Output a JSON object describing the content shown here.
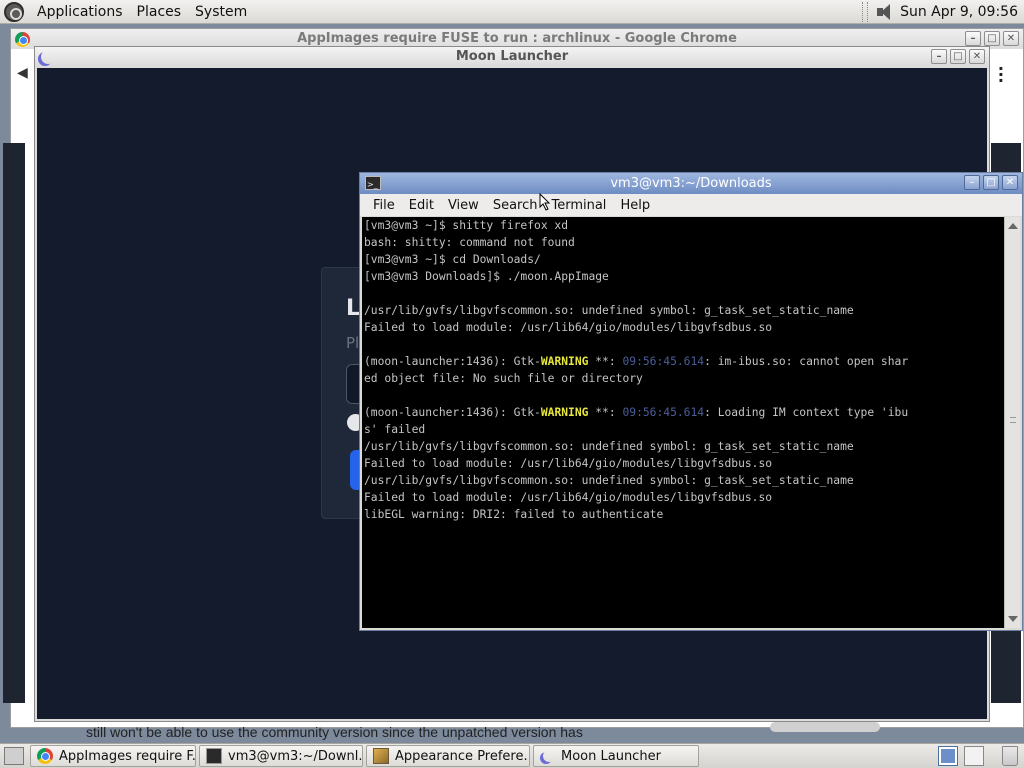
{
  "top_panel": {
    "menus": [
      "Applications",
      "Places",
      "System"
    ],
    "clock": "Sun Apr  9, 09:56"
  },
  "chrome": {
    "title": "AppImages require FUSE to run : archlinux - Google Chrome",
    "bottom_text": "still won't be able to use the community version since the unpatched version has"
  },
  "moon": {
    "title": "Moon Launcher",
    "card_heading_partial": "L",
    "card_sub_partial": "Pl"
  },
  "terminal": {
    "title": "vm3@vm3:~/Downloads",
    "menu": [
      "File",
      "Edit",
      "View",
      "Search",
      "Terminal",
      "Help"
    ],
    "lines": {
      "l1": "[vm3@vm3 ~]$ shitty firefox xd",
      "l2": "bash: shitty: command not found",
      "l3": "[vm3@vm3 ~]$ cd Downloads/",
      "l4": "[vm3@vm3 Downloads]$ ./moon.AppImage",
      "l5": "",
      "l6": "/usr/lib/gvfs/libgvfscommon.so: undefined symbol: g_task_set_static_name",
      "l7": "Failed to load module: /usr/lib64/gio/modules/libgvfsdbus.so",
      "l8": "",
      "l9_pre": "(moon-launcher:1436): Gtk-",
      "l9_warn": "WARNING",
      "l9_mid": " **: ",
      "l9_ts": "09:56:45.614",
      "l9_post": ": im-ibus.so: cannot open shar",
      "l10": "ed object file: No such file or directory",
      "l11": "",
      "l12_pre": "(moon-launcher:1436): Gtk-",
      "l12_warn": "WARNING",
      "l12_mid": " **: ",
      "l12_ts": "09:56:45.614",
      "l12_post": ": Loading IM context type 'ibu",
      "l13": "s' failed",
      "l14": "/usr/lib/gvfs/libgvfscommon.so: undefined symbol: g_task_set_static_name",
      "l15": "Failed to load module: /usr/lib64/gio/modules/libgvfsdbus.so",
      "l16": "/usr/lib/gvfs/libgvfscommon.so: undefined symbol: g_task_set_static_name",
      "l17": "Failed to load module: /usr/lib64/gio/modules/libgvfsdbus.so",
      "l18": "libEGL warning: DRI2: failed to authenticate"
    }
  },
  "taskbar": {
    "tasks": [
      "AppImages require F...",
      "vm3@vm3:~/Downl...",
      "Appearance Prefere...",
      "Moon Launcher"
    ]
  },
  "icons": {
    "chrome": "chrome-icon",
    "terminal": "terminal-icon",
    "moon": "moon-icon",
    "speaker": "speaker-icon",
    "trash": "trash-icon"
  },
  "colors": {
    "term_bg": "#000000",
    "term_text": "#c4c4c4",
    "warning": "#e8e83c",
    "timestamp": "#4a5d98",
    "moon_bg": "#141b2c",
    "titlebar_active": "#7f9ccf"
  }
}
